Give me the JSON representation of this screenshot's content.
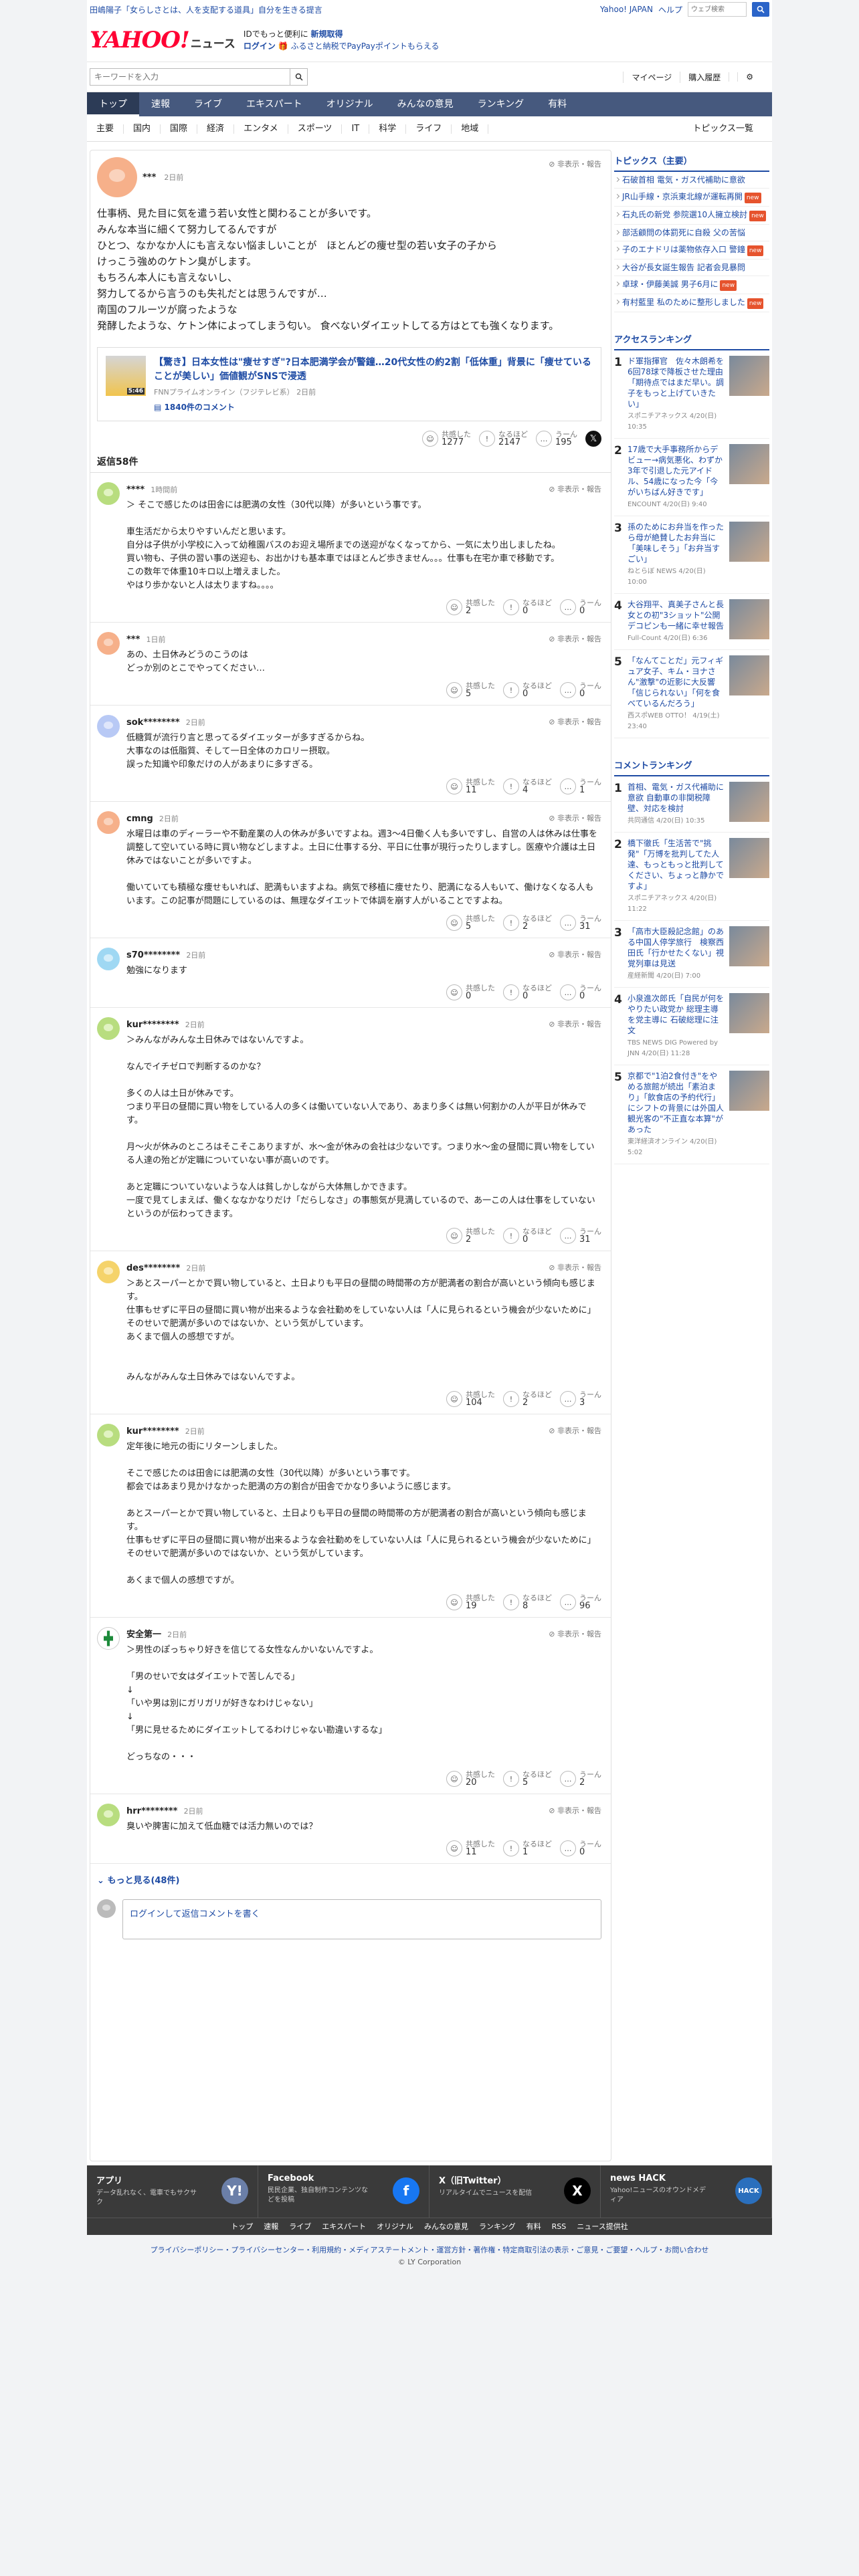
{
  "promo": {
    "text": "田嶋陽子「女らしさとは、人を支配する道具」自分を生きる提言",
    "yj": "Yahoo! JAPAN",
    "help": "ヘルプ",
    "search_placeholder": "ウェブ検索"
  },
  "mast": {
    "logo": "YAHOO!",
    "logo_sub": "JAPAN",
    "service": "ニュース",
    "msg1": "IDでもっと便利に",
    "msg1b": "新規取得",
    "login": "ログイン",
    "msg2": "ふるさと納税でPayPayポイントもらえる"
  },
  "search": {
    "placeholder": "キーワードを入力",
    "mypage": "マイページ",
    "history": "購入履歴"
  },
  "nav": [
    "トップ",
    "速報",
    "ライブ",
    "エキスパート",
    "オリジナル",
    "みんなの意見",
    "ランキング",
    "有料"
  ],
  "subnav": [
    "主要",
    "国内",
    "国際",
    "経済",
    "エンタメ",
    "スポーツ",
    "IT",
    "科学",
    "ライフ",
    "地域"
  ],
  "topics_list": "トピックス一覧",
  "post": {
    "user": "***",
    "time": "2日前",
    "report": "非表示・報告",
    "body": "仕事柄、見た目に気を遣う若い女性と関わることが多いです。\nみんな本当に細くて努力してるんですが\nひとつ、なかなか人にも言えない悩ましいことが　ほとんどの痩せ型の若い女子の子から\nけっこう強めのケトン臭がします。\nもちろん本人にも言えないし、\n努力してるから言うのも失礼だとは思うんですが…\n南国のフルーツが腐ったような\n発酵したような、ケトン体によってしまう匂い。 食べないダイエットしてる方はとても強くなります。",
    "article": {
      "title": "【驚き】日本女性は\"痩せすぎ\"?日本肥満学会が警鐘…20代女性の約2割「低体重」背景に「痩せていることが美しい」価値観がSNSで浸透",
      "source": "FNNプライムオンライン（フジテレビ系）",
      "time": "2日前",
      "comments": "1840件のコメント",
      "badge": "5:46"
    },
    "reactions": {
      "l1": "共感した",
      "v1": "1277",
      "l2": "なるほど",
      "v2": "2147",
      "l3": "うーん",
      "v3": "195"
    }
  },
  "reply_count": "返信58件",
  "comments": [
    {
      "user": "****",
      "time": "1時間前",
      "text": "＞ そこで感じたのは田舎には肥満の女性（30代以降）が多いという事です。\n\n車生活だから太りやすいんだと思います。\n自分は子供が小学校に入って幼稚園バスのお迎え場所までの送迎がなくなってから、一気に太り出しましたね。\n買い物も、子供の習い事の送迎も、お出かけも基本車ではほとんど歩きません。。。仕事も在宅か車で移動です。\nこの数年で体重10キロ以上増えました。\nやはり歩かないと人は太りますね。。。。",
      "a": "2",
      "b": "0",
      "c": "0"
    },
    {
      "user": "***",
      "time": "1日前",
      "text": "あの、土日休みどうのこうのは\nどっか別のとこでやってください…",
      "a": "5",
      "b": "0",
      "c": "0"
    },
    {
      "user": "sok********",
      "time": "2日前",
      "text": "低糖質が流行り言と思ってるダイエッターが多すぎるからね。\n大事なのは低脂質、そして一日全体のカロリー摂取。\n誤った知識や印象だけの人があまりに多すぎる。",
      "a": "11",
      "b": "4",
      "c": "1"
    },
    {
      "user": "cmng",
      "time": "2日前",
      "text": "水曜日は車のディーラーや不動産業の人の休みが多いですよね。週3〜4日働く人も多いですし、自営の人は休みは仕事を調整して空いている時に買い物などしますよ。土日に仕事する分、平日に仕事が現行ったりしますし。医療や介護は土日休みではないことが多いですよ。\n\n働いていても積極な痩せもいれば、肥満もいますよね。病気で移植に痩せたり、肥満になる人もいて、働けなくなる人もいます。この記事が問題にしているのは、無理なダイエットで体調を崩す人がいることですよね。",
      "a": "5",
      "b": "2",
      "c": "31"
    },
    {
      "user": "s70********",
      "time": "2日前",
      "text": "勉強になります",
      "a": "0",
      "b": "0",
      "c": "0"
    },
    {
      "user": "kur********",
      "time": "2日前",
      "text": "＞みんながみんな土日休みではないんですよ。\n\nなんでイチゼロで判断するのかな？\n\n多くの人は土日が休みです。\nつまり平日の昼間に買い物をしている人の多くは働いていない人であり、あまり多くは無い何割かの人が平日が休みです。\n\n月～火が休みのところはそこそこありますが、水～金が休みの会社は少ないです。つまり水～金の昼間に買い物をしている人達の殆どが定職についていない事が高いのです。\n\nあと定職についていないような人は貧しかしながら大体無しかできます。\n一度で見てしまえば、働くななかなりだけ「だらしなさ」の事態気が見満しているので、あ一この人は仕事をしていないというのが伝わってきます。",
      "a": "2",
      "b": "0",
      "c": "31"
    },
    {
      "user": "des********",
      "time": "2日前",
      "text": "＞あとスーパーとかで買い物していると、土日よりも平日の昼間の時間帯の方が肥満者の割合が高いという傾向も感じます。\n仕事もせずに平日の昼間に買い物が出来るような会社勤めをしていない人は「人に見られるという機会が少ないために」そのせいで肥満が多いのではないか、という気がしています。\nあくまで個人の感想ですが。\n\n\nみんながみんな土日休みではないんですよ。",
      "a": "104",
      "b": "2",
      "c": "3"
    },
    {
      "user": "kur********",
      "time": "2日前",
      "text": "定年後に地元の街にリターンしました。\n\nそこで感じたのは田舎には肥満の女性（30代以降）が多いという事です。\n都会ではあまり見かけなかった肥満の方の割合が田舎でかなり多いように感じます。\n\nあとスーパーとかで買い物していると、土日よりも平日の昼間の時間帯の方が肥満者の割合が高いという傾向も感じます。\n仕事もせずに平日の昼間に買い物が出来るような会社勤めをしていない人は「人に見られるという機会が少ないために」そのせいで肥満が多いのではないか、という気がしています。\n\nあくまで個人の感想ですが。",
      "a": "19",
      "b": "8",
      "c": "96"
    },
    {
      "user": "安全第一",
      "time": "2日前",
      "text": "＞男性のぽっちゃり好きを信じてる女性なんかいないんですよ。\n\n「男のせいで女はダイエットで苦しんでる」\n↓\n「いや男は別にガリガリが好きなわけじゃない」\n↓\n「男に見せるためにダイエットしてるわけじゃない勘違いするな」\n\nどっちなの・・・",
      "a": "20",
      "b": "5",
      "c": "2"
    },
    {
      "user": "hrr********",
      "time": "2日前",
      "text": "臭いや脾害に加えて低血糖では活力無いのでは？",
      "a": "11",
      "b": "1",
      "c": "0"
    }
  ],
  "reaction_labels": {
    "a": "共感した",
    "b": "なるほど",
    "c": "うーん"
  },
  "more": "もっと見る(48件)",
  "reply_box": "ログインして返信コメントを書く",
  "sidebar": {
    "topics_title": "トピックス（主要）",
    "topics": [
      {
        "t": "石破首相 電気・ガス代補助に意欲",
        "tag": ""
      },
      {
        "t": "JR山手線・京浜東北線が運転再開",
        "tag": "new"
      },
      {
        "t": "石丸氏の新党 参院選10人擁立検討",
        "tag": "new"
      },
      {
        "t": "部活顧問の体罰死に自殺 父の苦悩",
        "tag": ""
      },
      {
        "t": "子のエナドリは薬物依存入口 警鐘",
        "tag": "new"
      },
      {
        "t": "大谷が長女誕生報告 記者会見暴問",
        "tag": ""
      },
      {
        "t": "卓球・伊藤美誠 男子6月に",
        "tag": "new"
      },
      {
        "t": "有村藍里 私のために整形しました",
        "tag": "new"
      }
    ],
    "access_title": "アクセスランキング",
    "access": [
      {
        "n": "1",
        "t": "ド軍指揮官　佐々木朗希を6回78球で降板させた理由「期待点ではまだ早い。調子をもっと上げていきたい」",
        "s": "スポニチアネックス 4/20(日) 10:35"
      },
      {
        "n": "2",
        "t": "17歳で大手事務所からデビュー→病気悪化、わずか3年で引退した元アイドル、54歳になった今「今がいちばん好きです」",
        "s": "ENCOUNT 4/20(日) 9:40"
      },
      {
        "n": "3",
        "t": "孫のためにお弁当を作ったら母が絶賛したお弁当に「美味しそう」「お弁当すごい」",
        "s": "ねとらぼ NEWS 4/20(日) 10:00"
      },
      {
        "n": "4",
        "t": "大谷翔平、真美子さんと長女との初\"3ショット\"公開 デコピンも一緒に幸せ報告",
        "s": "Full-Count 4/20(日) 6:36"
      },
      {
        "n": "5",
        "t": "「なんてことだ」元フィギュア女子、キム・ヨナさん\"激撃\"の近影に大反響「信じられない」「何を食べているんだろう」",
        "s": "西スポWEB OTTO！ 4/19(土) 23:40"
      }
    ],
    "comment_title": "コメントランキング",
    "cranking": [
      {
        "n": "1",
        "t": "首相、電気・ガス代補助に意欲 自動車の非関税障壁、対応を検討",
        "s": "共同通信 4/20(日) 10:35"
      },
      {
        "n": "2",
        "t": "橋下徹氏「生活苦で\"挑発\"「万博を批判してた人達、もっともっと批判してください、ちょっと静かですよ」",
        "s": "スポニチアネックス 4/20(日) 11:22"
      },
      {
        "n": "3",
        "t": "「高市大臣殺記念館」のある中国人停学旅行　検察西田氏「行かせたくない」視覚列車は見送",
        "s": "産経新聞 4/20(日) 7:00"
      },
      {
        "n": "4",
        "t": "小泉進次郎氏「自民が何をやりたい政党か 総理主導を党主導に 石破総理に注文",
        "s": "TBS NEWS DIG Powered by JNN 4/20(日) 11:28"
      },
      {
        "n": "5",
        "t": "京都で\"1泊2食付き\"をやめる旅館が続出「素泊まり」「飲食店の予約代行」にシフトの背景には外国人観光客の\"不正直な本算\"があった",
        "s": "東洋経済オンライン 4/20(日) 5:02"
      }
    ]
  },
  "footer": {
    "cards": [
      {
        "h": "アプリ",
        "d": "データ乱れなく、電車でもサクサク",
        "ic": "Y!"
      },
      {
        "h": "Facebook",
        "d": "民民企業、独自制作コンテンツなどを投稿",
        "ic": "f"
      },
      {
        "h": "X（旧Twitter）",
        "d": "リアルタイムでニュースを配信",
        "ic": "X"
      },
      {
        "h": "news HACK",
        "d": "Yahoo!ニュースのオウンドメディア",
        "ic": "HACK"
      }
    ],
    "nav": [
      "トップ",
      "速報",
      "ライブ",
      "エキスパート",
      "オリジナル",
      "みんなの意見",
      "ランキング",
      "有料",
      "RSS",
      "ニュース提供社"
    ],
    "links": "プライバシーポリシー・プライバシーセンター・利用規約・メディアステートメント・運営方針・著作権・特定商取引法の表示・ご意見・ご要望・ヘルプ・お問い合わせ",
    "copyright": "© LY Corporation"
  }
}
